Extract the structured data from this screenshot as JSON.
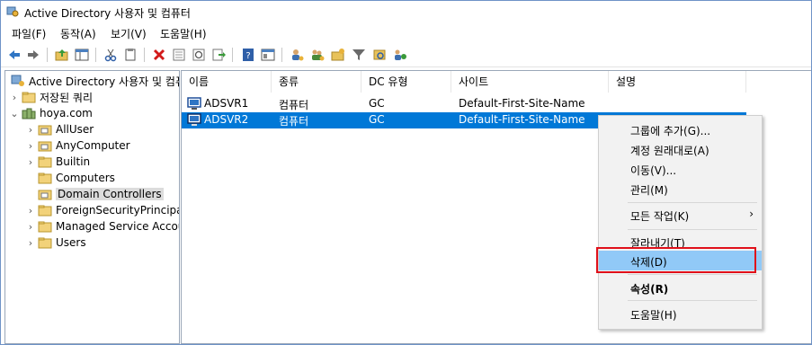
{
  "window": {
    "title": "Active Directory 사용자 및 컴퓨터"
  },
  "menu": [
    "파일(F)",
    "동작(A)",
    "보기(V)",
    "도움말(H)"
  ],
  "colors": {
    "selection": "#0078d7",
    "menu_highlight": "#91c9f7",
    "callout": "#e0101a"
  },
  "toolbar": [
    "back-icon",
    "forward-icon",
    "up-folder-icon",
    "show-console-tree-icon",
    "cut-icon",
    "copy-icon",
    "delete-icon",
    "properties-icon",
    "refresh-icon",
    "export-icon",
    "help-icon",
    "console-icon",
    "add-user-icon",
    "add-group-icon",
    "add-ou-icon",
    "filter-icon",
    "find-icon",
    "add-to-group-icon"
  ],
  "tree": {
    "root": "Active Directory 사용자 및 컴퓨터",
    "items": [
      {
        "label": "저장된 쿼리",
        "depth": 1,
        "expander": "›",
        "icon": "folder"
      },
      {
        "label": "hoya.com",
        "depth": 1,
        "expander": "⌄",
        "icon": "domain"
      },
      {
        "label": "AllUser",
        "depth": 2,
        "expander": "›",
        "icon": "ou"
      },
      {
        "label": "AnyComputer",
        "depth": 2,
        "expander": "›",
        "icon": "ou"
      },
      {
        "label": "Builtin",
        "depth": 2,
        "expander": "›",
        "icon": "folder"
      },
      {
        "label": "Computers",
        "depth": 2,
        "expander": "",
        "icon": "folder"
      },
      {
        "label": "Domain Controllers",
        "depth": 2,
        "expander": "",
        "icon": "ou",
        "selected": true
      },
      {
        "label": "ForeignSecurityPrincipals",
        "depth": 2,
        "expander": "›",
        "icon": "folder"
      },
      {
        "label": "Managed Service Accounts",
        "depth": 2,
        "expander": "›",
        "icon": "folder"
      },
      {
        "label": "Users",
        "depth": 2,
        "expander": "›",
        "icon": "folder"
      }
    ]
  },
  "list": {
    "columns": [
      "이름",
      "종류",
      "DC 유형",
      "사이트",
      "설명"
    ],
    "rows": [
      {
        "name": "ADSVR1",
        "type": "컴퓨터",
        "dc_type": "GC",
        "site": "Default-First-Site-Name",
        "description": "",
        "selected": false
      },
      {
        "name": "ADSVR2",
        "type": "컴퓨터",
        "dc_type": "GC",
        "site": "Default-First-Site-Name",
        "description": "",
        "selected": true
      }
    ]
  },
  "context_menu": {
    "items": [
      {
        "label": "그룹에 추가(G)..."
      },
      {
        "label": "계정 원래대로(A)"
      },
      {
        "label": "이동(V)..."
      },
      {
        "label": "관리(M)"
      },
      {
        "label": "모든 작업(K)",
        "submenu": "›"
      },
      {
        "label": "잘라내기(T)"
      },
      {
        "label": "삭제(D)",
        "highlighted": true
      },
      {
        "label": "속성(R)",
        "bold": true
      },
      {
        "label": "도움말(H)"
      }
    ]
  }
}
